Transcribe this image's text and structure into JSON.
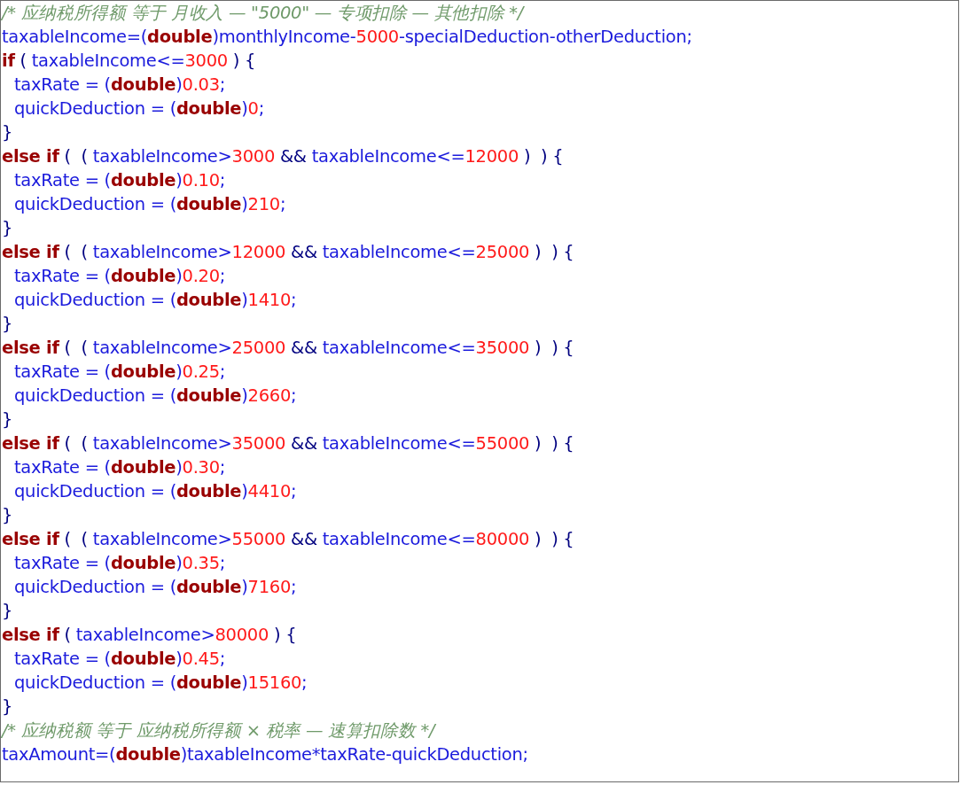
{
  "code_lines": [
    {
      "indent": false,
      "tokens": [
        {
          "kind": "comment",
          "text": "/* 应纳税所得额 等于 月收入 — \"5000\" — 专项扣除 — 其他扣除 */"
        }
      ]
    },
    {
      "indent": false,
      "tokens": [
        {
          "kind": "name",
          "text": "taxableIncome=("
        },
        {
          "kind": "keyword",
          "text": "double"
        },
        {
          "kind": "name",
          "text": ")monthlyIncome-"
        },
        {
          "kind": "number",
          "text": "5000"
        },
        {
          "kind": "name",
          "text": "-specialDeduction-otherDeduction;"
        }
      ]
    },
    {
      "indent": false,
      "tokens": [
        {
          "kind": "keyword",
          "text": "if"
        },
        {
          "kind": "brace",
          "text": " ( "
        },
        {
          "kind": "name",
          "text": "taxableIncome<="
        },
        {
          "kind": "number",
          "text": "3000"
        },
        {
          "kind": "brace",
          "text": " ) {"
        }
      ]
    },
    {
      "indent": true,
      "tokens": [
        {
          "kind": "name",
          "text": "taxRate = ("
        },
        {
          "kind": "keyword",
          "text": "double"
        },
        {
          "kind": "name",
          "text": ")"
        },
        {
          "kind": "number",
          "text": "0.03"
        },
        {
          "kind": "name",
          "text": ";"
        }
      ]
    },
    {
      "indent": true,
      "tokens": [
        {
          "kind": "name",
          "text": "quickDeduction = ("
        },
        {
          "kind": "keyword",
          "text": "double"
        },
        {
          "kind": "name",
          "text": ")"
        },
        {
          "kind": "number",
          "text": "0"
        },
        {
          "kind": "name",
          "text": ";"
        }
      ]
    },
    {
      "indent": false,
      "tokens": [
        {
          "kind": "brace",
          "text": "}"
        }
      ]
    },
    {
      "indent": false,
      "tokens": [
        {
          "kind": "keyword",
          "text": "else if"
        },
        {
          "kind": "brace",
          "text": " (  ( "
        },
        {
          "kind": "name",
          "text": "taxableIncome>"
        },
        {
          "kind": "number",
          "text": "3000"
        },
        {
          "kind": "brace",
          "text": " && "
        },
        {
          "kind": "name",
          "text": "taxableIncome<="
        },
        {
          "kind": "number",
          "text": "12000"
        },
        {
          "kind": "brace",
          "text": " )  ) {"
        }
      ]
    },
    {
      "indent": true,
      "tokens": [
        {
          "kind": "name",
          "text": "taxRate = ("
        },
        {
          "kind": "keyword",
          "text": "double"
        },
        {
          "kind": "name",
          "text": ")"
        },
        {
          "kind": "number",
          "text": "0.10"
        },
        {
          "kind": "name",
          "text": ";"
        }
      ]
    },
    {
      "indent": true,
      "tokens": [
        {
          "kind": "name",
          "text": "quickDeduction = ("
        },
        {
          "kind": "keyword",
          "text": "double"
        },
        {
          "kind": "name",
          "text": ")"
        },
        {
          "kind": "number",
          "text": "210"
        },
        {
          "kind": "name",
          "text": ";"
        }
      ]
    },
    {
      "indent": false,
      "tokens": [
        {
          "kind": "brace",
          "text": "}"
        }
      ]
    },
    {
      "indent": false,
      "tokens": [
        {
          "kind": "keyword",
          "text": "else if"
        },
        {
          "kind": "brace",
          "text": " (  ( "
        },
        {
          "kind": "name",
          "text": "taxableIncome>"
        },
        {
          "kind": "number",
          "text": "12000"
        },
        {
          "kind": "brace",
          "text": " && "
        },
        {
          "kind": "name",
          "text": "taxableIncome<="
        },
        {
          "kind": "number",
          "text": "25000"
        },
        {
          "kind": "brace",
          "text": " )  ) {"
        }
      ]
    },
    {
      "indent": true,
      "tokens": [
        {
          "kind": "name",
          "text": "taxRate = ("
        },
        {
          "kind": "keyword",
          "text": "double"
        },
        {
          "kind": "name",
          "text": ")"
        },
        {
          "kind": "number",
          "text": "0.20"
        },
        {
          "kind": "name",
          "text": ";"
        }
      ]
    },
    {
      "indent": true,
      "tokens": [
        {
          "kind": "name",
          "text": "quickDeduction = ("
        },
        {
          "kind": "keyword",
          "text": "double"
        },
        {
          "kind": "name",
          "text": ")"
        },
        {
          "kind": "number",
          "text": "1410"
        },
        {
          "kind": "name",
          "text": ";"
        }
      ]
    },
    {
      "indent": false,
      "tokens": [
        {
          "kind": "brace",
          "text": "}"
        }
      ]
    },
    {
      "indent": false,
      "tokens": [
        {
          "kind": "keyword",
          "text": "else if"
        },
        {
          "kind": "brace",
          "text": " (  ( "
        },
        {
          "kind": "name",
          "text": "taxableIncome>"
        },
        {
          "kind": "number",
          "text": "25000"
        },
        {
          "kind": "brace",
          "text": " && "
        },
        {
          "kind": "name",
          "text": "taxableIncome<="
        },
        {
          "kind": "number",
          "text": "35000"
        },
        {
          "kind": "brace",
          "text": " )  ) {"
        }
      ]
    },
    {
      "indent": true,
      "tokens": [
        {
          "kind": "name",
          "text": "taxRate = ("
        },
        {
          "kind": "keyword",
          "text": "double"
        },
        {
          "kind": "name",
          "text": ")"
        },
        {
          "kind": "number",
          "text": "0.25"
        },
        {
          "kind": "name",
          "text": ";"
        }
      ]
    },
    {
      "indent": true,
      "tokens": [
        {
          "kind": "name",
          "text": "quickDeduction = ("
        },
        {
          "kind": "keyword",
          "text": "double"
        },
        {
          "kind": "name",
          "text": ")"
        },
        {
          "kind": "number",
          "text": "2660"
        },
        {
          "kind": "name",
          "text": ";"
        }
      ]
    },
    {
      "indent": false,
      "tokens": [
        {
          "kind": "brace",
          "text": "}"
        }
      ]
    },
    {
      "indent": false,
      "tokens": [
        {
          "kind": "keyword",
          "text": "else if"
        },
        {
          "kind": "brace",
          "text": " (  ( "
        },
        {
          "kind": "name",
          "text": "taxableIncome>"
        },
        {
          "kind": "number",
          "text": "35000"
        },
        {
          "kind": "brace",
          "text": " && "
        },
        {
          "kind": "name",
          "text": "taxableIncome<="
        },
        {
          "kind": "number",
          "text": "55000"
        },
        {
          "kind": "brace",
          "text": " )  ) {"
        }
      ]
    },
    {
      "indent": true,
      "tokens": [
        {
          "kind": "name",
          "text": "taxRate = ("
        },
        {
          "kind": "keyword",
          "text": "double"
        },
        {
          "kind": "name",
          "text": ")"
        },
        {
          "kind": "number",
          "text": "0.30"
        },
        {
          "kind": "name",
          "text": ";"
        }
      ]
    },
    {
      "indent": true,
      "tokens": [
        {
          "kind": "name",
          "text": "quickDeduction = ("
        },
        {
          "kind": "keyword",
          "text": "double"
        },
        {
          "kind": "name",
          "text": ")"
        },
        {
          "kind": "number",
          "text": "4410"
        },
        {
          "kind": "name",
          "text": ";"
        }
      ]
    },
    {
      "indent": false,
      "tokens": [
        {
          "kind": "brace",
          "text": "}"
        }
      ]
    },
    {
      "indent": false,
      "tokens": [
        {
          "kind": "keyword",
          "text": "else if"
        },
        {
          "kind": "brace",
          "text": " (  ( "
        },
        {
          "kind": "name",
          "text": "taxableIncome>"
        },
        {
          "kind": "number",
          "text": "55000"
        },
        {
          "kind": "brace",
          "text": " && "
        },
        {
          "kind": "name",
          "text": "taxableIncome<="
        },
        {
          "kind": "number",
          "text": "80000"
        },
        {
          "kind": "brace",
          "text": " )  ) {"
        }
      ]
    },
    {
      "indent": true,
      "tokens": [
        {
          "kind": "name",
          "text": "taxRate = ("
        },
        {
          "kind": "keyword",
          "text": "double"
        },
        {
          "kind": "name",
          "text": ")"
        },
        {
          "kind": "number",
          "text": "0.35"
        },
        {
          "kind": "name",
          "text": ";"
        }
      ]
    },
    {
      "indent": true,
      "tokens": [
        {
          "kind": "name",
          "text": "quickDeduction = ("
        },
        {
          "kind": "keyword",
          "text": "double"
        },
        {
          "kind": "name",
          "text": ")"
        },
        {
          "kind": "number",
          "text": "7160"
        },
        {
          "kind": "name",
          "text": ";"
        }
      ]
    },
    {
      "indent": false,
      "tokens": [
        {
          "kind": "brace",
          "text": "}"
        }
      ]
    },
    {
      "indent": false,
      "tokens": [
        {
          "kind": "keyword",
          "text": "else if"
        },
        {
          "kind": "brace",
          "text": " ( "
        },
        {
          "kind": "name",
          "text": "taxableIncome>"
        },
        {
          "kind": "number",
          "text": "80000"
        },
        {
          "kind": "brace",
          "text": " ) {"
        }
      ]
    },
    {
      "indent": true,
      "tokens": [
        {
          "kind": "name",
          "text": "taxRate = ("
        },
        {
          "kind": "keyword",
          "text": "double"
        },
        {
          "kind": "name",
          "text": ")"
        },
        {
          "kind": "number",
          "text": "0.45"
        },
        {
          "kind": "name",
          "text": ";"
        }
      ]
    },
    {
      "indent": true,
      "tokens": [
        {
          "kind": "name",
          "text": "quickDeduction = ("
        },
        {
          "kind": "keyword",
          "text": "double"
        },
        {
          "kind": "name",
          "text": ")"
        },
        {
          "kind": "number",
          "text": "15160"
        },
        {
          "kind": "name",
          "text": ";"
        }
      ]
    },
    {
      "indent": false,
      "tokens": [
        {
          "kind": "brace",
          "text": "}"
        }
      ]
    },
    {
      "indent": false,
      "tokens": [
        {
          "kind": "comment",
          "text": "/* 应纳税额 等于 应纳税所得额 × 税率 — 速算扣除数 */"
        }
      ]
    },
    {
      "indent": false,
      "tokens": [
        {
          "kind": "name",
          "text": "taxAmount=("
        },
        {
          "kind": "keyword",
          "text": "double"
        },
        {
          "kind": "name",
          "text": ")taxableIncome*taxRate-quickDeduction;"
        }
      ]
    }
  ]
}
